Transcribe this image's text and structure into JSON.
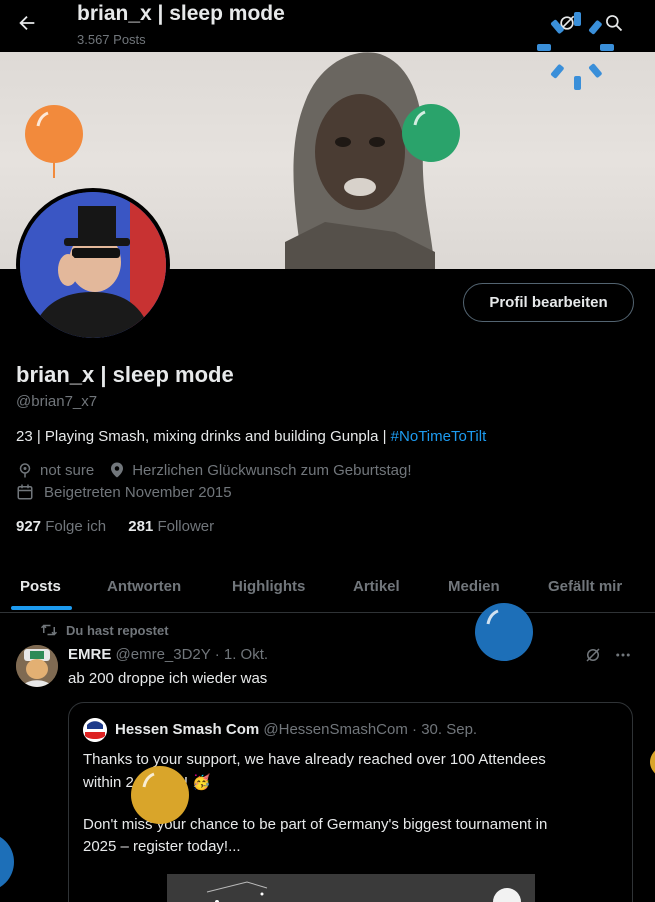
{
  "header": {
    "title": "brian_x | sleep mode",
    "posts_count": "3.567 Posts"
  },
  "profile": {
    "edit_label": "Profil bearbeiten",
    "display_name": "brian_x | sleep mode",
    "handle": "@brian7_x7",
    "bio_text": "23 | Playing Smash, mixing drinks and building Gunpla | ",
    "bio_hashtag": "#NoTimeToTilt",
    "pronouns": "not sure",
    "location": "Herzlichen Glückwunsch zum Geburtstag!",
    "joined": "Beigetreten November 2015",
    "following_count": "927",
    "following_label": "Folge ich",
    "followers_count": "281",
    "followers_label": "Follower"
  },
  "tabs": [
    {
      "label": "Posts"
    },
    {
      "label": "Antworten"
    },
    {
      "label": "Highlights"
    },
    {
      "label": "Artikel"
    },
    {
      "label": "Medien"
    },
    {
      "label": "Gefällt mir"
    }
  ],
  "post": {
    "repost_label": "Du hast repostet",
    "author_name": "EMRE",
    "author_handle": "@emre_3D2Y",
    "separator": "·",
    "date": "1. Okt.",
    "text": "ab 200 droppe ich wieder was",
    "quote": {
      "author_name": "Hessen Smash Com",
      "author_handle": "@HessenSmashCom",
      "separator": "·",
      "date": "30. Sep.",
      "line1": "Thanks to your support, we have already reached over 100 Attendees",
      "line2": "within 24 hours! 🥳",
      "line3": "Don't miss your chance to be part of Germany's biggest tournament in",
      "line4": "2025 – register today!..."
    }
  },
  "icons": {
    "back": "arrow-left-icon",
    "grok": "grok-icon",
    "search": "search-icon",
    "balloon": "birthday-balloon-icon",
    "location": "location-pin-icon",
    "calendar": "calendar-icon",
    "repost": "repost-icon",
    "more": "more-icon"
  },
  "colors": {
    "accent": "#1d9bf0",
    "muted": "#71767b",
    "text": "#e7e9ea",
    "balloon_orange": "#f28a3c",
    "balloon_green": "#2aa36b",
    "balloon_blue": "#1d6fb8",
    "balloon_yellow": "#d9a52a"
  }
}
